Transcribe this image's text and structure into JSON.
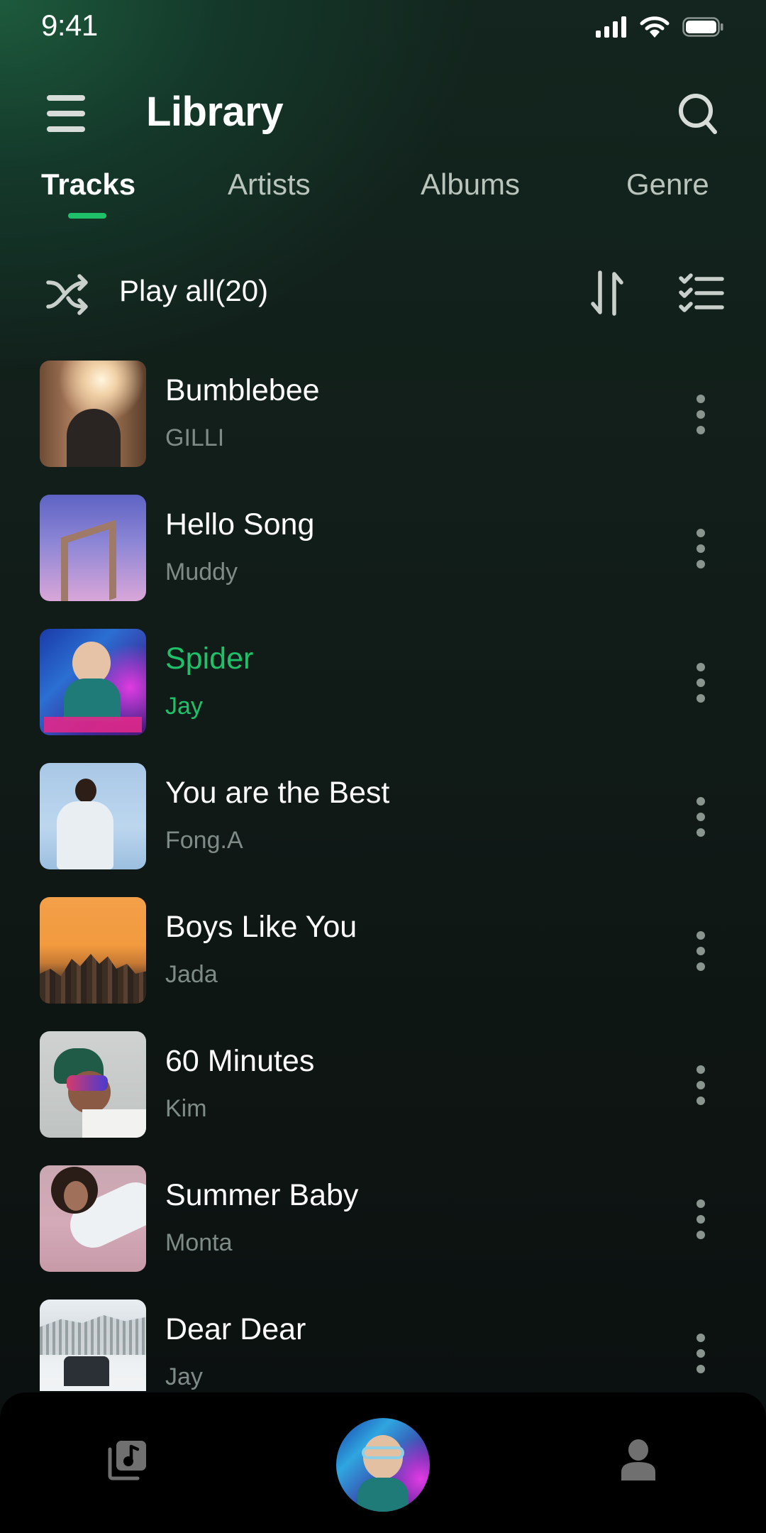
{
  "status_bar": {
    "time": "9:41",
    "icons": [
      "signal-icon",
      "wifi-icon",
      "battery-icon"
    ]
  },
  "header": {
    "title": "Library",
    "menu_icon": "hamburger-menu-icon",
    "search_icon": "search-icon"
  },
  "tabs": [
    {
      "label": "Tracks",
      "active": true
    },
    {
      "label": "Artists",
      "active": false
    },
    {
      "label": "Albums",
      "active": false
    },
    {
      "label": "Genre",
      "active": false
    }
  ],
  "toolbar": {
    "shuffle_icon": "shuffle-icon",
    "play_all_label": "Play all(20)",
    "sort_icon": "sort-icon",
    "select_icon": "checklist-icon"
  },
  "tracks": [
    {
      "title": "Bumblebee",
      "artist": "GILLI",
      "playing": false
    },
    {
      "title": "Hello Song",
      "artist": "Muddy",
      "playing": false
    },
    {
      "title": "Spider",
      "artist": "Jay",
      "playing": true
    },
    {
      "title": "You are the Best",
      "artist": "Fong.A",
      "playing": false
    },
    {
      "title": "Boys Like You",
      "artist": "Jada",
      "playing": false
    },
    {
      "title": "60 Minutes",
      "artist": "Kim",
      "playing": false
    },
    {
      "title": "Summer Baby",
      "artist": "Monta",
      "playing": false
    },
    {
      "title": "Dear Dear",
      "artist": "Jay",
      "playing": false
    }
  ],
  "bottom_nav": {
    "items": [
      "library-music-icon",
      "now-playing-artwork",
      "profile-icon"
    ]
  },
  "colors": {
    "accent": "#1fc06a",
    "background": "#111c18",
    "secondary_text": "#7f8b86",
    "nav_background": "#000000"
  }
}
